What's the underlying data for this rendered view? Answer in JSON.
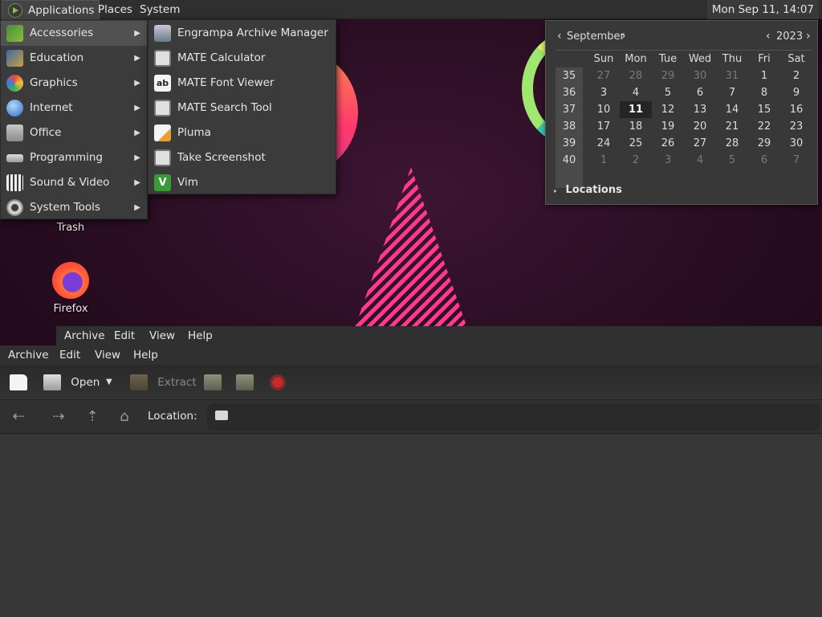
{
  "top_panel": {
    "menus": [
      "Applications",
      "Places",
      "System"
    ],
    "clock": "Mon Sep 11, 14:07"
  },
  "applications_menu": {
    "items": [
      {
        "label": "Accessories",
        "icon": "accessories-icon"
      },
      {
        "label": "Education",
        "icon": "education-icon"
      },
      {
        "label": "Graphics",
        "icon": "graphics-icon"
      },
      {
        "label": "Internet",
        "icon": "internet-icon"
      },
      {
        "label": "Office",
        "icon": "office-icon"
      },
      {
        "label": "Programming",
        "icon": "programming-icon"
      },
      {
        "label": "Sound & Video",
        "icon": "sound-video-icon"
      },
      {
        "label": "System Tools",
        "icon": "system-tools-icon"
      }
    ],
    "active": "Accessories"
  },
  "accessories_submenu": {
    "items": [
      {
        "label": "Engrampa Archive Manager",
        "icon": "archive-manager-icon"
      },
      {
        "label": "MATE Calculator",
        "icon": "calculator-icon"
      },
      {
        "label": "MATE Font Viewer",
        "icon": "font-viewer-icon"
      },
      {
        "label": "MATE Search Tool",
        "icon": "search-tool-icon"
      },
      {
        "label": "Pluma",
        "icon": "pluma-icon"
      },
      {
        "label": "Take Screenshot",
        "icon": "screenshot-icon"
      },
      {
        "label": "Vim",
        "icon": "vim-icon"
      }
    ]
  },
  "calendar": {
    "month": "September",
    "year": "2023",
    "weekdays": [
      "Sun",
      "Mon",
      "Tue",
      "Wed",
      "Thu",
      "Fri",
      "Sat"
    ],
    "weeks": [
      {
        "num": "35",
        "days": [
          "27",
          "28",
          "29",
          "30",
          "31",
          "1",
          "2"
        ]
      },
      {
        "num": "36",
        "days": [
          "3",
          "4",
          "5",
          "6",
          "7",
          "8",
          "9"
        ]
      },
      {
        "num": "37",
        "days": [
          "10",
          "11",
          "12",
          "13",
          "14",
          "15",
          "16"
        ]
      },
      {
        "num": "38",
        "days": [
          "17",
          "18",
          "19",
          "20",
          "21",
          "22",
          "23"
        ]
      },
      {
        "num": "39",
        "days": [
          "24",
          "25",
          "26",
          "27",
          "28",
          "29",
          "30"
        ]
      },
      {
        "num": "40",
        "days": [
          "1",
          "2",
          "3",
          "4",
          "5",
          "6",
          "7"
        ]
      }
    ],
    "today": "11",
    "locations_label": "Locations"
  },
  "desktop": {
    "icons": [
      {
        "label": "Trash"
      },
      {
        "label": "Firefox"
      }
    ]
  },
  "archive_window": {
    "back_menubar": [
      "Archive",
      "Edit",
      "View",
      "Help"
    ],
    "menubar": [
      "Archive",
      "Edit",
      "View",
      "Help"
    ],
    "toolbar": {
      "open_label": "Open",
      "extract_label": "Extract"
    },
    "location_label": "Location:"
  }
}
